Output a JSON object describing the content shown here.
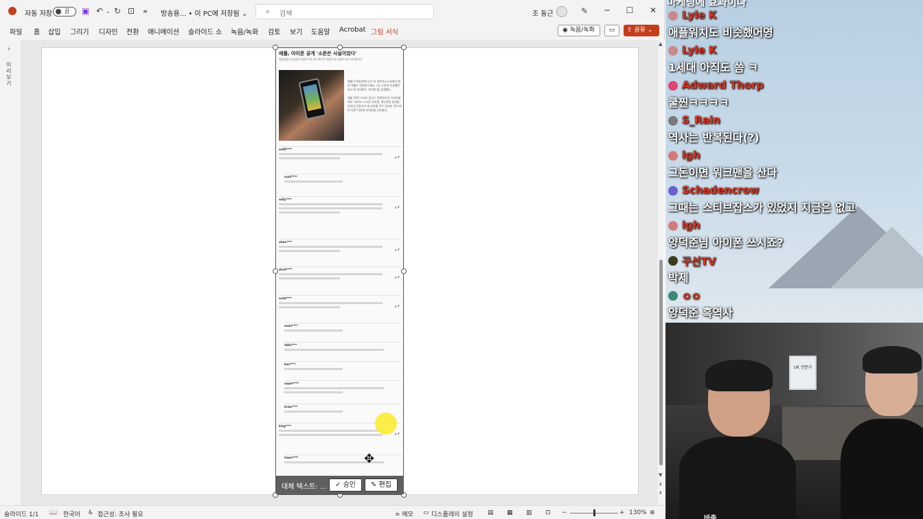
{
  "titlebar": {
    "autosave_label": "자동 저장",
    "autosave_state": "끔",
    "doc_title": "방송용... • 이 PC에 저장됨 ⌄",
    "search_placeholder": "검색",
    "user_name": "조 동근"
  },
  "menu": [
    {
      "label": "파일",
      "active": false
    },
    {
      "label": "홈",
      "active": false
    },
    {
      "label": "삽입",
      "active": false
    },
    {
      "label": "그리기",
      "active": false
    },
    {
      "label": "디자인",
      "active": false
    },
    {
      "label": "전환",
      "active": false
    },
    {
      "label": "애니메이션",
      "active": false
    },
    {
      "label": "슬라이드 쇼",
      "active": false
    },
    {
      "label": "녹음/녹화",
      "active": false
    },
    {
      "label": "검토",
      "active": false
    },
    {
      "label": "보기",
      "active": false
    },
    {
      "label": "도움말",
      "active": false
    },
    {
      "label": "Acrobat",
      "active": false
    },
    {
      "label": "그림 서식",
      "active": true
    }
  ],
  "ribbon_right": {
    "record_label": "◉ 녹음/녹화",
    "share_label": "⇪ 공유 ⌄"
  },
  "left_pane": {
    "vertical_text": "미리보기"
  },
  "article": {
    "title": "애플, 아이폰 공개 '소문은 사실이었다'",
    "meta": "백팔경쟁  기사입력 2007-01-10 09:57  최종수정 2007-01-10 09:57",
    "body_p1": "애플이 9일(현지시간) 미 샌프란시스코에서 열린 맥월드 컨퍼런스에서 그간 소문만 무성했던 자사 첫 휴대폰인 '아이폰'을 공개했다.",
    "body_p2": "애플 CEO 스티브 잡스는 컨퍼런스의 기조연설에서 \"와이드 스크린 아이팟, 혁신적인 휴대폰, 인터넷 전광기가 세 가지를 모두 망라한 것이 바로 아폰\"이라며 아이폰을 선보였다.",
    "comments": [
      "oatD****",
      "sse3****",
      "willy****",
      "ahue****",
      "duch****",
      "nutd****",
      "mulu****",
      "ddlu****",
      "kan****",
      "super****",
      "kraw****",
      "king****",
      "hawe****"
    ]
  },
  "alt_text": {
    "label": "대체 텍스트: ...",
    "approve": "승인",
    "edit": "편집"
  },
  "status": {
    "slide": "슬라이드 1/1",
    "language": "한국어",
    "accessibility": "접근성: 조사 필요",
    "notes": "≐ 메모",
    "display": "디스플레이 설정",
    "zoom": "130%"
  },
  "chat": {
    "top_partial": "마케팅에 효과이다",
    "messages": [
      {
        "name": "Lyle K",
        "text": "애플워치도 비슷했어영",
        "color": "#e0311c",
        "avatar": "#c98a8a"
      },
      {
        "name": "Lyle K",
        "text": "1세대 아직도 씀 ㅋ",
        "color": "#e0311c",
        "avatar": "#c98a8a"
      },
      {
        "name": "Adward Thorp",
        "text": "쿨찐ㅋㅋㅋㅋ",
        "color": "#e0311c",
        "avatar": "#e04478"
      },
      {
        "name": "S_Rain",
        "text": "역사는 반복된다(?)",
        "color": "#e0311c",
        "avatar": "#7a7a7a"
      },
      {
        "name": "lgh",
        "text": "그돈이면 워크맨을 산다",
        "color": "#e0311c",
        "avatar": "#d47a7a"
      },
      {
        "name": "Schadencrow",
        "text": "그때는 스티브잡스가 있었지 지금은 없고",
        "color": "#e0311c",
        "avatar": "#6b5fd0"
      },
      {
        "name": "lgh",
        "text": "양덕준님 아이폰 쓰시죠?",
        "color": "#e0311c",
        "avatar": "#d47a7a"
      },
      {
        "name": "꾸선TV",
        "text": "박제",
        "color": "#e0311c",
        "avatar": "#3d3d1c"
      },
      {
        "name": "ㅇㅇ",
        "text": "양덕준 흑역사",
        "color": "#e0311c",
        "avatar": "#3a8a76"
      }
    ]
  },
  "cam": {
    "frame_text": "UK 전문가",
    "caption": "바축"
  }
}
